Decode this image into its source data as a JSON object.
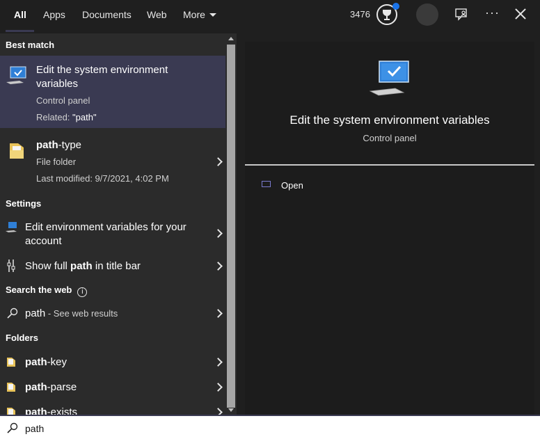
{
  "tabs": [
    {
      "label": "All"
    },
    {
      "label": "Apps"
    },
    {
      "label": "Documents"
    },
    {
      "label": "Web"
    },
    {
      "label": "More"
    }
  ],
  "rewards_points": "3476",
  "sections": {
    "best_match": "Best match",
    "settings": "Settings",
    "search_the_web": "Search the web",
    "folders": "Folders"
  },
  "best_match": {
    "title_line1": "Edit the system environment",
    "title_line2": "variables",
    "category": "Control panel",
    "related_prefix": "Related: ",
    "related_term": "\"path\""
  },
  "folder_result": {
    "title_match": "path",
    "title_rest": "-type",
    "kind": "File folder",
    "modified": "Last modified: 9/7/2021, 4:02 PM"
  },
  "settings_items": [
    {
      "line1": "Edit environment variables for your",
      "line2": "account"
    },
    {
      "pre": "Show full ",
      "match": "path",
      "post": " in title bar"
    }
  ],
  "web_result": {
    "query": "path",
    "suffix": " - See web results"
  },
  "folder_items": [
    {
      "match": "path",
      "rest": "-key"
    },
    {
      "match": "path",
      "rest": "-parse"
    },
    {
      "match": "path",
      "rest": "-exists"
    }
  ],
  "detail": {
    "title": "Edit the system environment variables",
    "subtitle": "Control panel",
    "action_open": "Open"
  },
  "search": {
    "value": "path"
  },
  "colors": {
    "accent": "#3a3a52",
    "panel": "#2b2b2b",
    "background": "#1f1f1f"
  }
}
